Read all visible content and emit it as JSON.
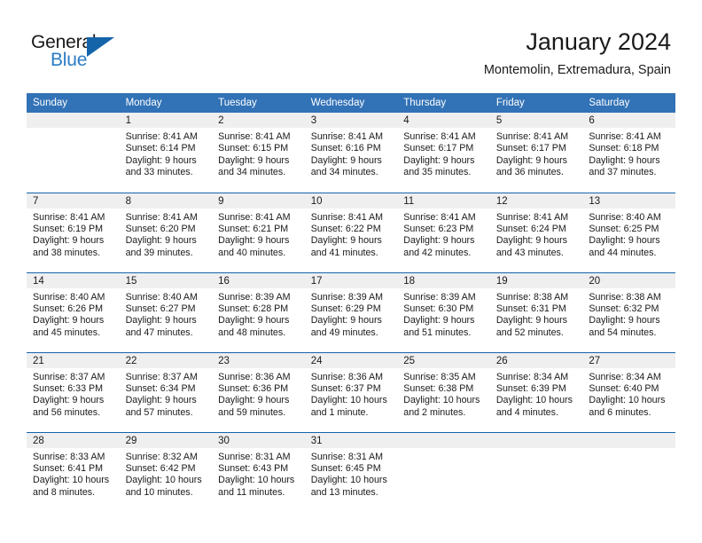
{
  "brand": {
    "name_part1": "General",
    "name_part2": "Blue"
  },
  "header": {
    "title": "January 2024",
    "subtitle": "Montemolin, Extremadura, Spain"
  },
  "colors": {
    "header_blue": "#3272b6",
    "rule_blue": "#1464aa",
    "daynum_band": "#efefef",
    "logo_blue": "#2b7cc4",
    "text": "#1a1a1a"
  },
  "weekday_headers": [
    "Sunday",
    "Monday",
    "Tuesday",
    "Wednesday",
    "Thursday",
    "Friday",
    "Saturday"
  ],
  "labels": {
    "sunrise_prefix": "Sunrise:",
    "sunset_prefix": "Sunset:",
    "daylight_prefix": "Daylight:"
  },
  "weeks": [
    [
      {
        "day": "",
        "sunrise": "",
        "sunset": "",
        "daylight_line1": "",
        "daylight_line2": ""
      },
      {
        "day": "1",
        "sunrise": "Sunrise: 8:41 AM",
        "sunset": "Sunset: 6:14 PM",
        "daylight_line1": "Daylight: 9 hours",
        "daylight_line2": "and 33 minutes."
      },
      {
        "day": "2",
        "sunrise": "Sunrise: 8:41 AM",
        "sunset": "Sunset: 6:15 PM",
        "daylight_line1": "Daylight: 9 hours",
        "daylight_line2": "and 34 minutes."
      },
      {
        "day": "3",
        "sunrise": "Sunrise: 8:41 AM",
        "sunset": "Sunset: 6:16 PM",
        "daylight_line1": "Daylight: 9 hours",
        "daylight_line2": "and 34 minutes."
      },
      {
        "day": "4",
        "sunrise": "Sunrise: 8:41 AM",
        "sunset": "Sunset: 6:17 PM",
        "daylight_line1": "Daylight: 9 hours",
        "daylight_line2": "and 35 minutes."
      },
      {
        "day": "5",
        "sunrise": "Sunrise: 8:41 AM",
        "sunset": "Sunset: 6:17 PM",
        "daylight_line1": "Daylight: 9 hours",
        "daylight_line2": "and 36 minutes."
      },
      {
        "day": "6",
        "sunrise": "Sunrise: 8:41 AM",
        "sunset": "Sunset: 6:18 PM",
        "daylight_line1": "Daylight: 9 hours",
        "daylight_line2": "and 37 minutes."
      }
    ],
    [
      {
        "day": "7",
        "sunrise": "Sunrise: 8:41 AM",
        "sunset": "Sunset: 6:19 PM",
        "daylight_line1": "Daylight: 9 hours",
        "daylight_line2": "and 38 minutes."
      },
      {
        "day": "8",
        "sunrise": "Sunrise: 8:41 AM",
        "sunset": "Sunset: 6:20 PM",
        "daylight_line1": "Daylight: 9 hours",
        "daylight_line2": "and 39 minutes."
      },
      {
        "day": "9",
        "sunrise": "Sunrise: 8:41 AM",
        "sunset": "Sunset: 6:21 PM",
        "daylight_line1": "Daylight: 9 hours",
        "daylight_line2": "and 40 minutes."
      },
      {
        "day": "10",
        "sunrise": "Sunrise: 8:41 AM",
        "sunset": "Sunset: 6:22 PM",
        "daylight_line1": "Daylight: 9 hours",
        "daylight_line2": "and 41 minutes."
      },
      {
        "day": "11",
        "sunrise": "Sunrise: 8:41 AM",
        "sunset": "Sunset: 6:23 PM",
        "daylight_line1": "Daylight: 9 hours",
        "daylight_line2": "and 42 minutes."
      },
      {
        "day": "12",
        "sunrise": "Sunrise: 8:41 AM",
        "sunset": "Sunset: 6:24 PM",
        "daylight_line1": "Daylight: 9 hours",
        "daylight_line2": "and 43 minutes."
      },
      {
        "day": "13",
        "sunrise": "Sunrise: 8:40 AM",
        "sunset": "Sunset: 6:25 PM",
        "daylight_line1": "Daylight: 9 hours",
        "daylight_line2": "and 44 minutes."
      }
    ],
    [
      {
        "day": "14",
        "sunrise": "Sunrise: 8:40 AM",
        "sunset": "Sunset: 6:26 PM",
        "daylight_line1": "Daylight: 9 hours",
        "daylight_line2": "and 45 minutes."
      },
      {
        "day": "15",
        "sunrise": "Sunrise: 8:40 AM",
        "sunset": "Sunset: 6:27 PM",
        "daylight_line1": "Daylight: 9 hours",
        "daylight_line2": "and 47 minutes."
      },
      {
        "day": "16",
        "sunrise": "Sunrise: 8:39 AM",
        "sunset": "Sunset: 6:28 PM",
        "daylight_line1": "Daylight: 9 hours",
        "daylight_line2": "and 48 minutes."
      },
      {
        "day": "17",
        "sunrise": "Sunrise: 8:39 AM",
        "sunset": "Sunset: 6:29 PM",
        "daylight_line1": "Daylight: 9 hours",
        "daylight_line2": "and 49 minutes."
      },
      {
        "day": "18",
        "sunrise": "Sunrise: 8:39 AM",
        "sunset": "Sunset: 6:30 PM",
        "daylight_line1": "Daylight: 9 hours",
        "daylight_line2": "and 51 minutes."
      },
      {
        "day": "19",
        "sunrise": "Sunrise: 8:38 AM",
        "sunset": "Sunset: 6:31 PM",
        "daylight_line1": "Daylight: 9 hours",
        "daylight_line2": "and 52 minutes."
      },
      {
        "day": "20",
        "sunrise": "Sunrise: 8:38 AM",
        "sunset": "Sunset: 6:32 PM",
        "daylight_line1": "Daylight: 9 hours",
        "daylight_line2": "and 54 minutes."
      }
    ],
    [
      {
        "day": "21",
        "sunrise": "Sunrise: 8:37 AM",
        "sunset": "Sunset: 6:33 PM",
        "daylight_line1": "Daylight: 9 hours",
        "daylight_line2": "and 56 minutes."
      },
      {
        "day": "22",
        "sunrise": "Sunrise: 8:37 AM",
        "sunset": "Sunset: 6:34 PM",
        "daylight_line1": "Daylight: 9 hours",
        "daylight_line2": "and 57 minutes."
      },
      {
        "day": "23",
        "sunrise": "Sunrise: 8:36 AM",
        "sunset": "Sunset: 6:36 PM",
        "daylight_line1": "Daylight: 9 hours",
        "daylight_line2": "and 59 minutes."
      },
      {
        "day": "24",
        "sunrise": "Sunrise: 8:36 AM",
        "sunset": "Sunset: 6:37 PM",
        "daylight_line1": "Daylight: 10 hours",
        "daylight_line2": "and 1 minute."
      },
      {
        "day": "25",
        "sunrise": "Sunrise: 8:35 AM",
        "sunset": "Sunset: 6:38 PM",
        "daylight_line1": "Daylight: 10 hours",
        "daylight_line2": "and 2 minutes."
      },
      {
        "day": "26",
        "sunrise": "Sunrise: 8:34 AM",
        "sunset": "Sunset: 6:39 PM",
        "daylight_line1": "Daylight: 10 hours",
        "daylight_line2": "and 4 minutes."
      },
      {
        "day": "27",
        "sunrise": "Sunrise: 8:34 AM",
        "sunset": "Sunset: 6:40 PM",
        "daylight_line1": "Daylight: 10 hours",
        "daylight_line2": "and 6 minutes."
      }
    ],
    [
      {
        "day": "28",
        "sunrise": "Sunrise: 8:33 AM",
        "sunset": "Sunset: 6:41 PM",
        "daylight_line1": "Daylight: 10 hours",
        "daylight_line2": "and 8 minutes."
      },
      {
        "day": "29",
        "sunrise": "Sunrise: 8:32 AM",
        "sunset": "Sunset: 6:42 PM",
        "daylight_line1": "Daylight: 10 hours",
        "daylight_line2": "and 10 minutes."
      },
      {
        "day": "30",
        "sunrise": "Sunrise: 8:31 AM",
        "sunset": "Sunset: 6:43 PM",
        "daylight_line1": "Daylight: 10 hours",
        "daylight_line2": "and 11 minutes."
      },
      {
        "day": "31",
        "sunrise": "Sunrise: 8:31 AM",
        "sunset": "Sunset: 6:45 PM",
        "daylight_line1": "Daylight: 10 hours",
        "daylight_line2": "and 13 minutes."
      },
      {
        "day": "",
        "sunrise": "",
        "sunset": "",
        "daylight_line1": "",
        "daylight_line2": ""
      },
      {
        "day": "",
        "sunrise": "",
        "sunset": "",
        "daylight_line1": "",
        "daylight_line2": ""
      },
      {
        "day": "",
        "sunrise": "",
        "sunset": "",
        "daylight_line1": "",
        "daylight_line2": ""
      }
    ]
  ]
}
